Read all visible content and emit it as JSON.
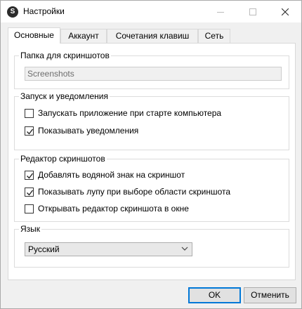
{
  "window": {
    "title": "Настройки",
    "app_icon_glyph": "S"
  },
  "tabs": [
    {
      "label": "Основные",
      "active": true
    },
    {
      "label": "Аккаунт",
      "active": false
    },
    {
      "label": "Сочетания клавиш",
      "active": false
    },
    {
      "label": "Сеть",
      "active": false
    }
  ],
  "screenshot_folder": {
    "title": "Папка для скриншотов",
    "value": "Screenshots"
  },
  "startup": {
    "title": "Запуск и уведомления",
    "options": [
      {
        "label": "Запускать приложение при старте компьютера",
        "checked": false
      },
      {
        "label": "Показывать уведомления",
        "checked": true
      }
    ]
  },
  "editor": {
    "title": "Редактор скриншотов",
    "options": [
      {
        "label": "Добавлять водяной знак на скриншот",
        "checked": true
      },
      {
        "label": "Показывать лупу при выборе области скриншота",
        "checked": true
      },
      {
        "label": "Открывать редактор скриншота в окне",
        "checked": false
      }
    ]
  },
  "language": {
    "title": "Язык",
    "selected": "Русский"
  },
  "buttons": {
    "ok": "OK",
    "cancel": "Отменить"
  },
  "colors": {
    "accent": "#0078d7",
    "window_bg": "#f0f0f0",
    "panel_bg": "#ffffff"
  },
  "icons": [
    "app-icon",
    "minimize-icon",
    "maximize-icon",
    "close-icon",
    "checkmark-icon",
    "chevron-down-icon"
  ]
}
